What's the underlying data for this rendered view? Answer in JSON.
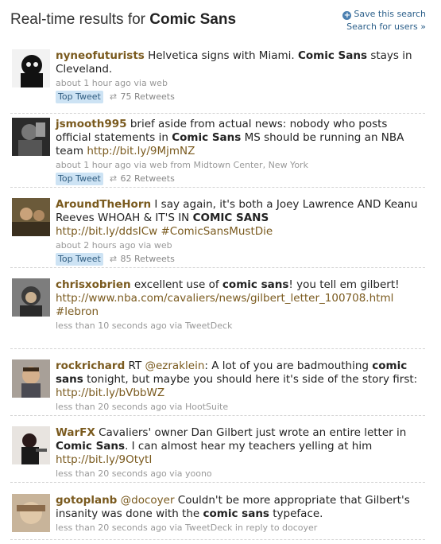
{
  "header": {
    "title_prefix": "Real-time results for ",
    "query": "Comic Sans",
    "save_search": "Save this search",
    "search_users": "Search for users »"
  },
  "tweets": [
    {
      "user": "nyneofuturists",
      "t1": " Helvetica signs with Miami. ",
      "k1": "Comic Sans",
      "t2": " stays in Cleveland.",
      "meta_time": "about 1 hour ago",
      "meta_via": " via web",
      "badge": "Top Tweet",
      "retweets": "75 Retweets"
    },
    {
      "user": "jsmooth995",
      "t1": " brief aside from actual news: nobody who posts official statements in ",
      "k1": "Comic Sans",
      "t2": " MS should be running an NBA team ",
      "link": "http://bit.ly/9MjmNZ",
      "meta_time": "about 1 hour ago",
      "meta_via": " via web from Midtown Center, New York",
      "badge": "Top Tweet",
      "retweets": "62 Retweets"
    },
    {
      "user": "AroundTheHorn",
      "t1": " I say again, it's both a Joey Lawrence AND Keanu Reeves WHOAH & IT'S IN ",
      "k1": "COMIC SANS",
      "link": "http://bit.ly/ddsICw",
      "link2": " #ComicSansMustDie",
      "meta_time": "about 2 hours ago",
      "meta_via": " via web",
      "badge": "Top Tweet",
      "retweets": "85 Retweets"
    },
    {
      "user": "chrisxobrien",
      "t1": " excellent use of ",
      "k1": "comic sans",
      "t2": "! you tell em gilbert!",
      "link": "http://www.nba.com/cavaliers/news/gilbert_letter_100708.html",
      "link2": " #lebron",
      "meta_time": "less than 10 seconds ago",
      "meta_via": " via TweetDeck"
    },
    {
      "user": "rockrichard",
      "t0": " RT ",
      "mention": "@ezraklein",
      "t1": ": A lot of you are badmouthing ",
      "k1": "comic sans",
      "t2": " tonight, but maybe you should here it's side of the story first: ",
      "link": "http://bit.ly/bVbbWZ",
      "meta_time": "less than 20 seconds ago",
      "meta_via": " via HootSuite"
    },
    {
      "user": "WarFX",
      "t1": " Cavaliers' owner Dan Gilbert just wrote an entire letter in ",
      "k1": "Comic Sans",
      "t2": ". I can almost hear my teachers yelling at him ",
      "link": "http://bit.ly/9OtytI",
      "meta_time": "less than 20 seconds ago",
      "meta_via": " via yoono"
    },
    {
      "user": "gotoplanb",
      "t0": " ",
      "mention": "@docoyer",
      "t1": " Couldn't be more appropriate that Gilbert's insanity was done with the ",
      "k1": "comic sans",
      "t2": " typeface.",
      "meta_time": "less than 20 seconds ago",
      "meta_via": " via TweetDeck in reply to docoyer"
    }
  ]
}
